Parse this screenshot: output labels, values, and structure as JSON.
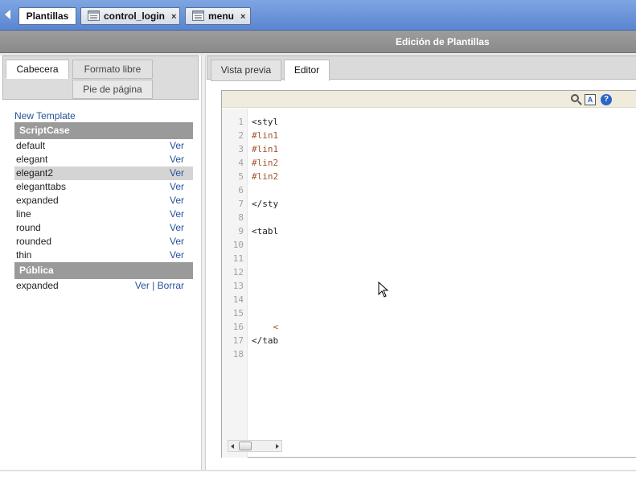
{
  "top_tabs": {
    "active": "Plantillas",
    "open": [
      {
        "label": "control_login"
      },
      {
        "label": "menu"
      }
    ],
    "close_glyph": "×"
  },
  "section": {
    "title": "Edición de Plantillas"
  },
  "left_tabs": {
    "cabecera": "Cabecera",
    "formato_libre": "Formato libre",
    "pie_de_pagina": "Pie de página"
  },
  "template_list": {
    "new_template": "New Template",
    "groups": [
      {
        "name": "ScriptCase",
        "items": [
          {
            "name": "default",
            "actions": "Ver"
          },
          {
            "name": "elegant",
            "actions": "Ver"
          },
          {
            "name": "elegant2",
            "actions": "Ver",
            "selected": true
          },
          {
            "name": "eleganttabs",
            "actions": "Ver"
          },
          {
            "name": "expanded",
            "actions": "Ver"
          },
          {
            "name": "line",
            "actions": "Ver"
          },
          {
            "name": "round",
            "actions": "Ver"
          },
          {
            "name": "rounded",
            "actions": "Ver"
          },
          {
            "name": "thin",
            "actions": "Ver"
          }
        ]
      },
      {
        "name": "Pública",
        "items": [
          {
            "name": "expanded",
            "view": "Ver",
            "sep": "|",
            "delete": "Borrar"
          }
        ]
      }
    ]
  },
  "right_tabs": {
    "preview": "Vista previa",
    "editor": "Editor"
  },
  "editor": {
    "toolbar_icons": [
      "search-icon",
      "replace-icon",
      "help-icon"
    ],
    "line_numbers": [
      "1",
      "2",
      "3",
      "4",
      "5",
      "6",
      "7",
      "8",
      "9",
      "10",
      "11",
      "12",
      "13",
      "14",
      "15",
      "16",
      "17",
      "18"
    ],
    "code_lines": [
      "<styl",
      "#lin1",
      "#lin1",
      "#lin2",
      "#lin2",
      "",
      "</sty",
      "",
      "<tabl",
      "",
      "",
      "",
      "",
      "",
      "",
      "    <",
      "</tab",
      ""
    ],
    "colors": {
      "css": "#a0522d",
      "tag": "#222222"
    }
  }
}
